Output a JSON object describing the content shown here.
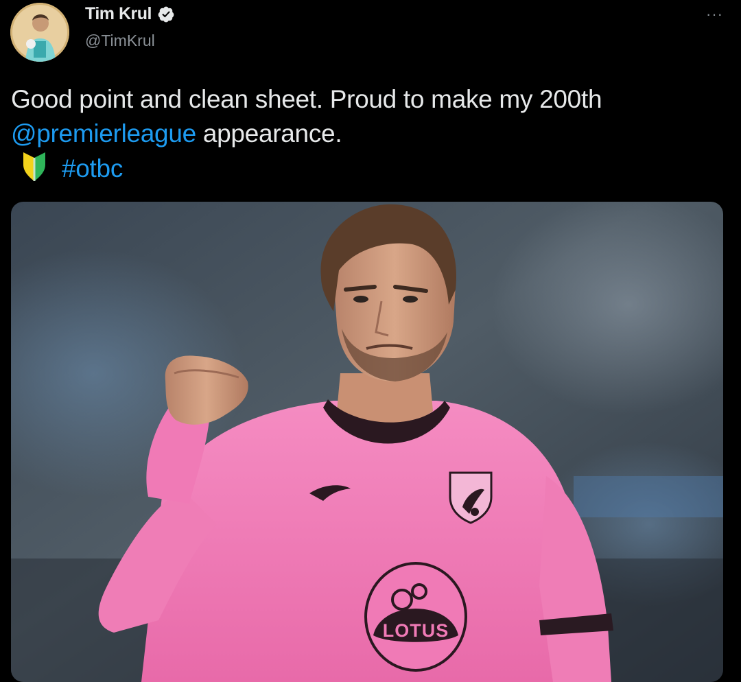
{
  "tweet": {
    "display_name": "Tim Krul",
    "handle": "@TimKrul",
    "more_icon": "more-icon",
    "verified_icon": "verified-badge-icon",
    "text_line1": "Good point and clean sheet.  Proud to make my 200th",
    "mention": "@premierleague",
    "text_line2_rest": " appearance.",
    "emoji_icon": "yellow-green-shield-icon",
    "hashtag": "#otbc"
  },
  "media": {
    "jersey_sponsor": "LOTUS"
  },
  "colors": {
    "background": "#000000",
    "text": "#e7e9ea",
    "secondary": "#8b9197",
    "link": "#1d9bf0",
    "jersey_pink": "#f07ab6"
  }
}
